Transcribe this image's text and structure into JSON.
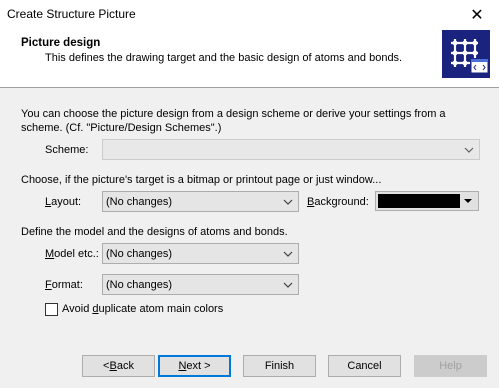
{
  "window": {
    "title": "Create Structure Picture",
    "close_symbol": "✕"
  },
  "header": {
    "title": "Picture design",
    "subtitle": "This defines the drawing target and the basic design of atoms and bonds.",
    "logo_icon": "grid-picture-icon"
  },
  "intro": {
    "line1": "You can choose the picture design from a design scheme or derive your settings from a",
    "line2": "scheme. (Cf. \"Picture/Design Schemes\".)"
  },
  "scheme": {
    "label": "Scheme:",
    "value": ""
  },
  "target": {
    "text": "Choose, if the picture's target is a bitmap or printout page or just  window...",
    "layout_label_pre": "",
    "layout_label_u": "L",
    "layout_label_post": "ayout:",
    "layout_value": "(No changes)",
    "background_label_pre": "",
    "background_label_u": "B",
    "background_label_post": "ackground:",
    "background_color": "#000000"
  },
  "model": {
    "text": "Define the model and the designs of atoms and bonds.",
    "model_label_pre": "",
    "model_label_u": "M",
    "model_label_post": "odel etc.:",
    "model_value": "(No changes)",
    "format_label_pre": "",
    "format_label_u": "F",
    "format_label_post": "ormat:",
    "format_value": "(No changes)",
    "avoid_pre": "Avoid ",
    "avoid_u": "d",
    "avoid_post": "uplicate atom main colors",
    "avoid_checked": false
  },
  "buttons": {
    "back_pre": "< ",
    "back_u": "B",
    "back_post": "ack",
    "next_pre": "",
    "next_u": "N",
    "next_post": "ext >",
    "finish": "Finish",
    "cancel": "Cancel",
    "help": "Help"
  }
}
